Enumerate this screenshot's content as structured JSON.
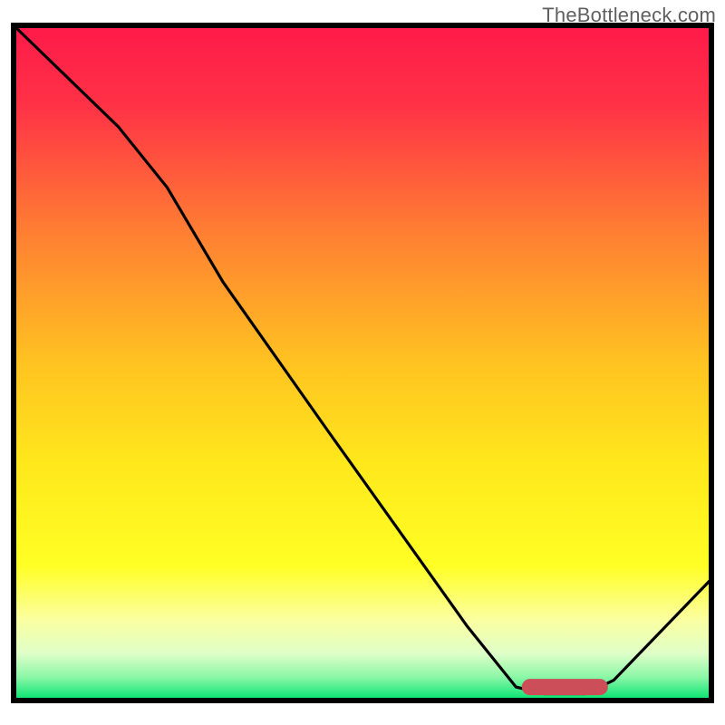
{
  "watermark": "TheBottleneck.com",
  "colors": {
    "curve": "#000000",
    "marker": "#cc4e58",
    "border": "#000000"
  },
  "chart_data": {
    "type": "line",
    "title": "",
    "xlabel": "",
    "ylabel": "",
    "xlim": [
      0,
      100
    ],
    "ylim": [
      0,
      100
    ],
    "axes_visible": false,
    "grid": false,
    "background_gradient": {
      "direction": "vertical",
      "stops": [
        {
          "offset": 0.0,
          "color": "#fe1a49"
        },
        {
          "offset": 0.12,
          "color": "#ff3246"
        },
        {
          "offset": 0.3,
          "color": "#ff7c33"
        },
        {
          "offset": 0.5,
          "color": "#ffc321"
        },
        {
          "offset": 0.65,
          "color": "#ffe81c"
        },
        {
          "offset": 0.8,
          "color": "#ffff24"
        },
        {
          "offset": 0.88,
          "color": "#fbffa0"
        },
        {
          "offset": 0.93,
          "color": "#dfffc8"
        },
        {
          "offset": 0.965,
          "color": "#8cf7a8"
        },
        {
          "offset": 1.0,
          "color": "#00e36e"
        }
      ]
    },
    "curve_points": [
      {
        "x": 0,
        "y": 100
      },
      {
        "x": 15,
        "y": 85
      },
      {
        "x": 22,
        "y": 76
      },
      {
        "x": 30,
        "y": 62
      },
      {
        "x": 45,
        "y": 40
      },
      {
        "x": 65,
        "y": 11
      },
      {
        "x": 72,
        "y": 2
      },
      {
        "x": 76,
        "y": 1
      },
      {
        "x": 82,
        "y": 1
      },
      {
        "x": 86,
        "y": 3
      },
      {
        "x": 100,
        "y": 18
      }
    ],
    "optimal_range": {
      "x_start": 74,
      "x_end": 84,
      "y": 2
    }
  }
}
